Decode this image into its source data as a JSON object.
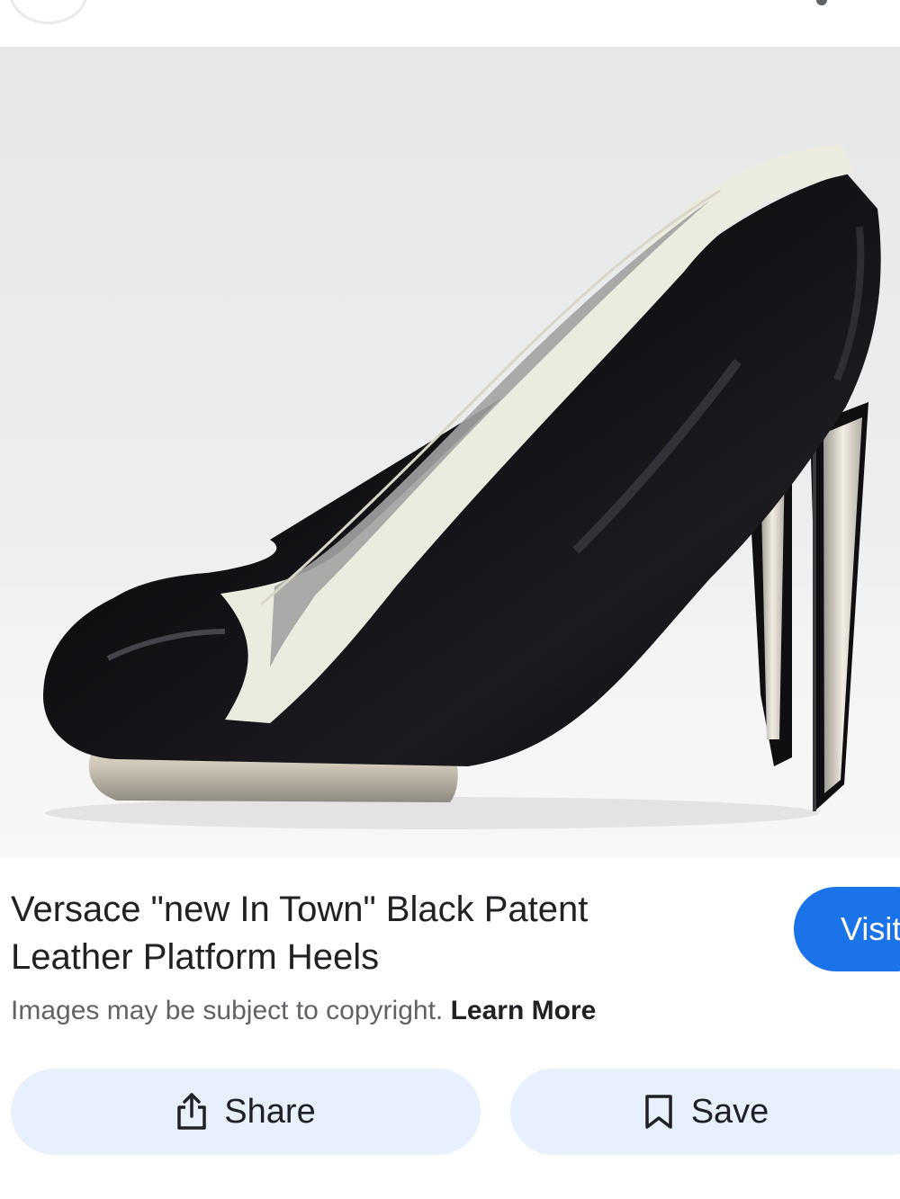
{
  "top_bar": {
    "icons": [
      "menu-circle-icon",
      "more-vert-icon"
    ]
  },
  "product": {
    "image_alt": "Black patent leather platform pump with cream trim and metallic heel",
    "title": "Versace \"new In Town\" Black Patent Leather Platform Heels",
    "visit_label": "Visit"
  },
  "notice": {
    "text": "Images may be subject to copyright.",
    "link_label": "Learn More"
  },
  "actions": {
    "share_label": "Share",
    "share_icon": "share-icon",
    "save_label": "Save",
    "save_icon": "bookmark-icon"
  },
  "colors": {
    "accent": "#1a73e8",
    "pill_bg": "#e8f0fe",
    "text_primary": "#202124",
    "text_secondary": "#5f6368"
  }
}
